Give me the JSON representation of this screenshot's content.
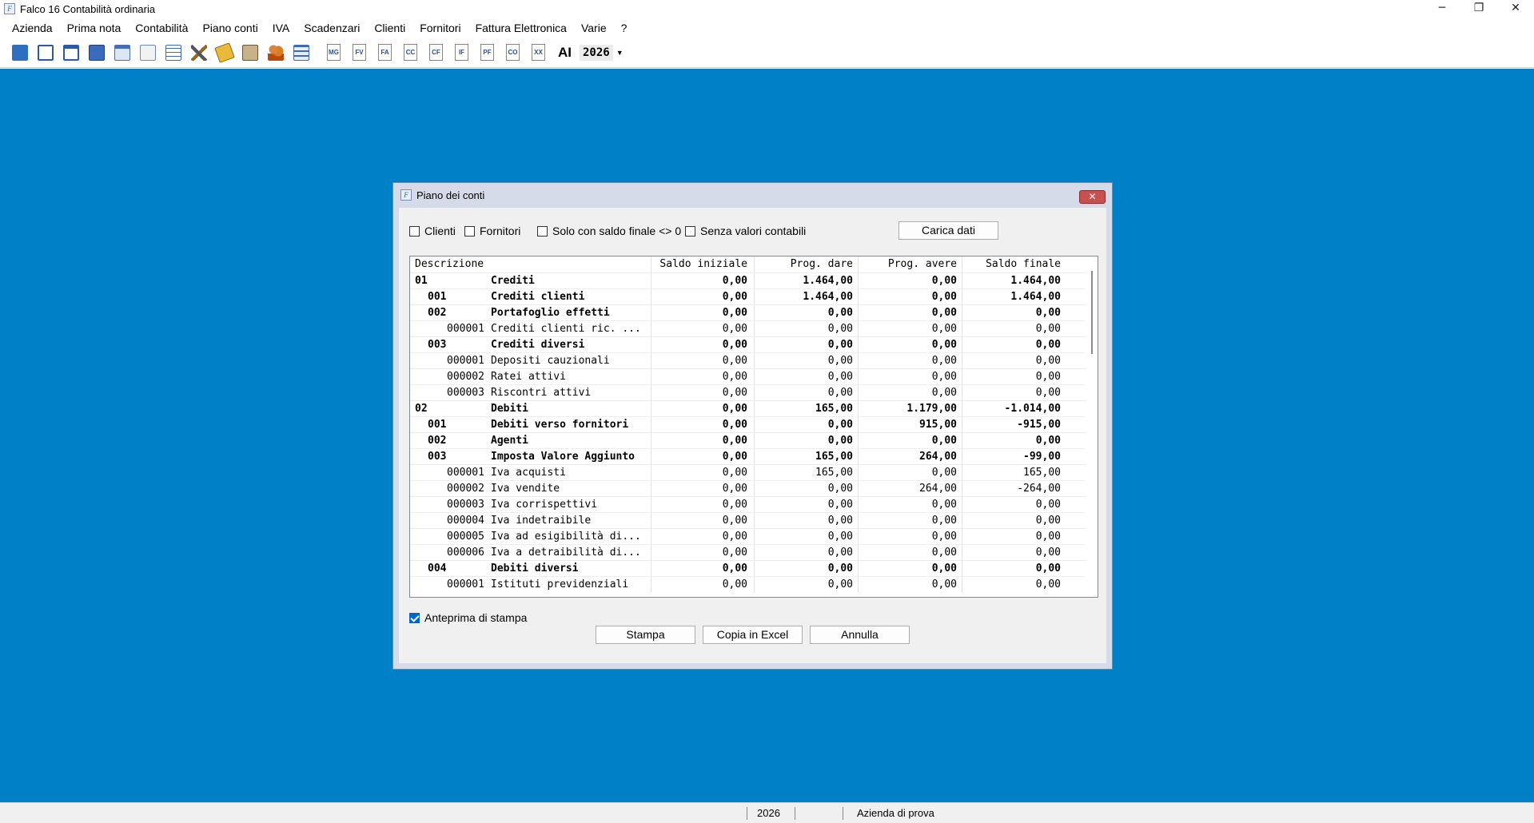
{
  "window": {
    "title": "Falco 16 Contabilità ordinaria",
    "minimize": "─",
    "maximize": "❐",
    "close": "✕"
  },
  "menu": [
    "Azienda",
    "Prima nota",
    "Contabilità",
    "Piano conti",
    "IVA",
    "Scadenzari",
    "Clienti",
    "Fornitori",
    "Fattura Elettronica",
    "Varie",
    "?"
  ],
  "toolbar": {
    "doc_buttons": [
      "MG",
      "FV",
      "FA",
      "CC",
      "CF",
      "IF",
      "PF",
      "CO",
      "XX"
    ],
    "ai_label": "AI",
    "year": "2026",
    "year_arrow": "▼"
  },
  "status": {
    "year": "2026",
    "company": "Azienda di prova"
  },
  "dialog": {
    "title": "Piano dei conti",
    "close": "✕",
    "checkboxes": [
      {
        "label": "Clienti",
        "checked": false
      },
      {
        "label": "Fornitori",
        "checked": false
      },
      {
        "label": "Solo con saldo finale <> 0",
        "checked": false
      },
      {
        "label": "Senza valori contabili",
        "checked": false
      }
    ],
    "load_button": "Carica dati",
    "preview": {
      "label": "Anteprima di stampa",
      "checked": true
    },
    "buttons": {
      "print": "Stampa",
      "copy_excel": "Copia in Excel",
      "cancel": "Annulla"
    },
    "columns": [
      "Descrizione",
      "Saldo iniziale",
      "Prog. dare",
      "Prog. avere",
      "Saldo finale"
    ],
    "rows": [
      {
        "code": "01",
        "name": "Crediti",
        "level": 0,
        "bold": true,
        "v": [
          "0,00",
          "1.464,00",
          "0,00",
          "1.464,00"
        ]
      },
      {
        "code": "001",
        "name": "Crediti clienti",
        "level": 1,
        "bold": true,
        "v": [
          "0,00",
          "1.464,00",
          "0,00",
          "1.464,00"
        ]
      },
      {
        "code": "002",
        "name": "Portafoglio effetti",
        "level": 1,
        "bold": true,
        "v": [
          "0,00",
          "0,00",
          "0,00",
          "0,00"
        ]
      },
      {
        "code": "000001",
        "name": "Crediti clienti ric. ...",
        "level": 2,
        "bold": false,
        "v": [
          "0,00",
          "0,00",
          "0,00",
          "0,00"
        ]
      },
      {
        "code": "003",
        "name": "Crediti diversi",
        "level": 1,
        "bold": true,
        "v": [
          "0,00",
          "0,00",
          "0,00",
          "0,00"
        ]
      },
      {
        "code": "000001",
        "name": "Depositi cauzionali",
        "level": 2,
        "bold": false,
        "v": [
          "0,00",
          "0,00",
          "0,00",
          "0,00"
        ]
      },
      {
        "code": "000002",
        "name": "Ratei attivi",
        "level": 2,
        "bold": false,
        "v": [
          "0,00",
          "0,00",
          "0,00",
          "0,00"
        ]
      },
      {
        "code": "000003",
        "name": "Riscontri attivi",
        "level": 2,
        "bold": false,
        "v": [
          "0,00",
          "0,00",
          "0,00",
          "0,00"
        ]
      },
      {
        "code": "02",
        "name": "Debiti",
        "level": 0,
        "bold": true,
        "v": [
          "0,00",
          "165,00",
          "1.179,00",
          "-1.014,00"
        ]
      },
      {
        "code": "001",
        "name": "Debiti verso fornitori",
        "level": 1,
        "bold": true,
        "v": [
          "0,00",
          "0,00",
          "915,00",
          "-915,00"
        ]
      },
      {
        "code": "002",
        "name": "Agenti",
        "level": 1,
        "bold": true,
        "v": [
          "0,00",
          "0,00",
          "0,00",
          "0,00"
        ]
      },
      {
        "code": "003",
        "name": "Imposta Valore Aggiunto",
        "level": 1,
        "bold": true,
        "v": [
          "0,00",
          "165,00",
          "264,00",
          "-99,00"
        ]
      },
      {
        "code": "000001",
        "name": "Iva acquisti",
        "level": 2,
        "bold": false,
        "v": [
          "0,00",
          "165,00",
          "0,00",
          "165,00"
        ]
      },
      {
        "code": "000002",
        "name": "Iva vendite",
        "level": 2,
        "bold": false,
        "v": [
          "0,00",
          "0,00",
          "264,00",
          "-264,00"
        ]
      },
      {
        "code": "000003",
        "name": "Iva corrispettivi",
        "level": 2,
        "bold": false,
        "v": [
          "0,00",
          "0,00",
          "0,00",
          "0,00"
        ]
      },
      {
        "code": "000004",
        "name": "Iva indetraibile",
        "level": 2,
        "bold": false,
        "v": [
          "0,00",
          "0,00",
          "0,00",
          "0,00"
        ]
      },
      {
        "code": "000005",
        "name": "Iva ad esigibilità di...",
        "level": 2,
        "bold": false,
        "v": [
          "0,00",
          "0,00",
          "0,00",
          "0,00"
        ]
      },
      {
        "code": "000006",
        "name": "Iva a detraibilità di...",
        "level": 2,
        "bold": false,
        "v": [
          "0,00",
          "0,00",
          "0,00",
          "0,00"
        ]
      },
      {
        "code": "004",
        "name": "Debiti diversi",
        "level": 1,
        "bold": true,
        "v": [
          "0,00",
          "0,00",
          "0,00",
          "0,00"
        ]
      },
      {
        "code": "000001",
        "name": "Istituti previdenziali",
        "level": 2,
        "bold": false,
        "v": [
          "0,00",
          "0,00",
          "0,00",
          "0,00"
        ]
      }
    ]
  }
}
